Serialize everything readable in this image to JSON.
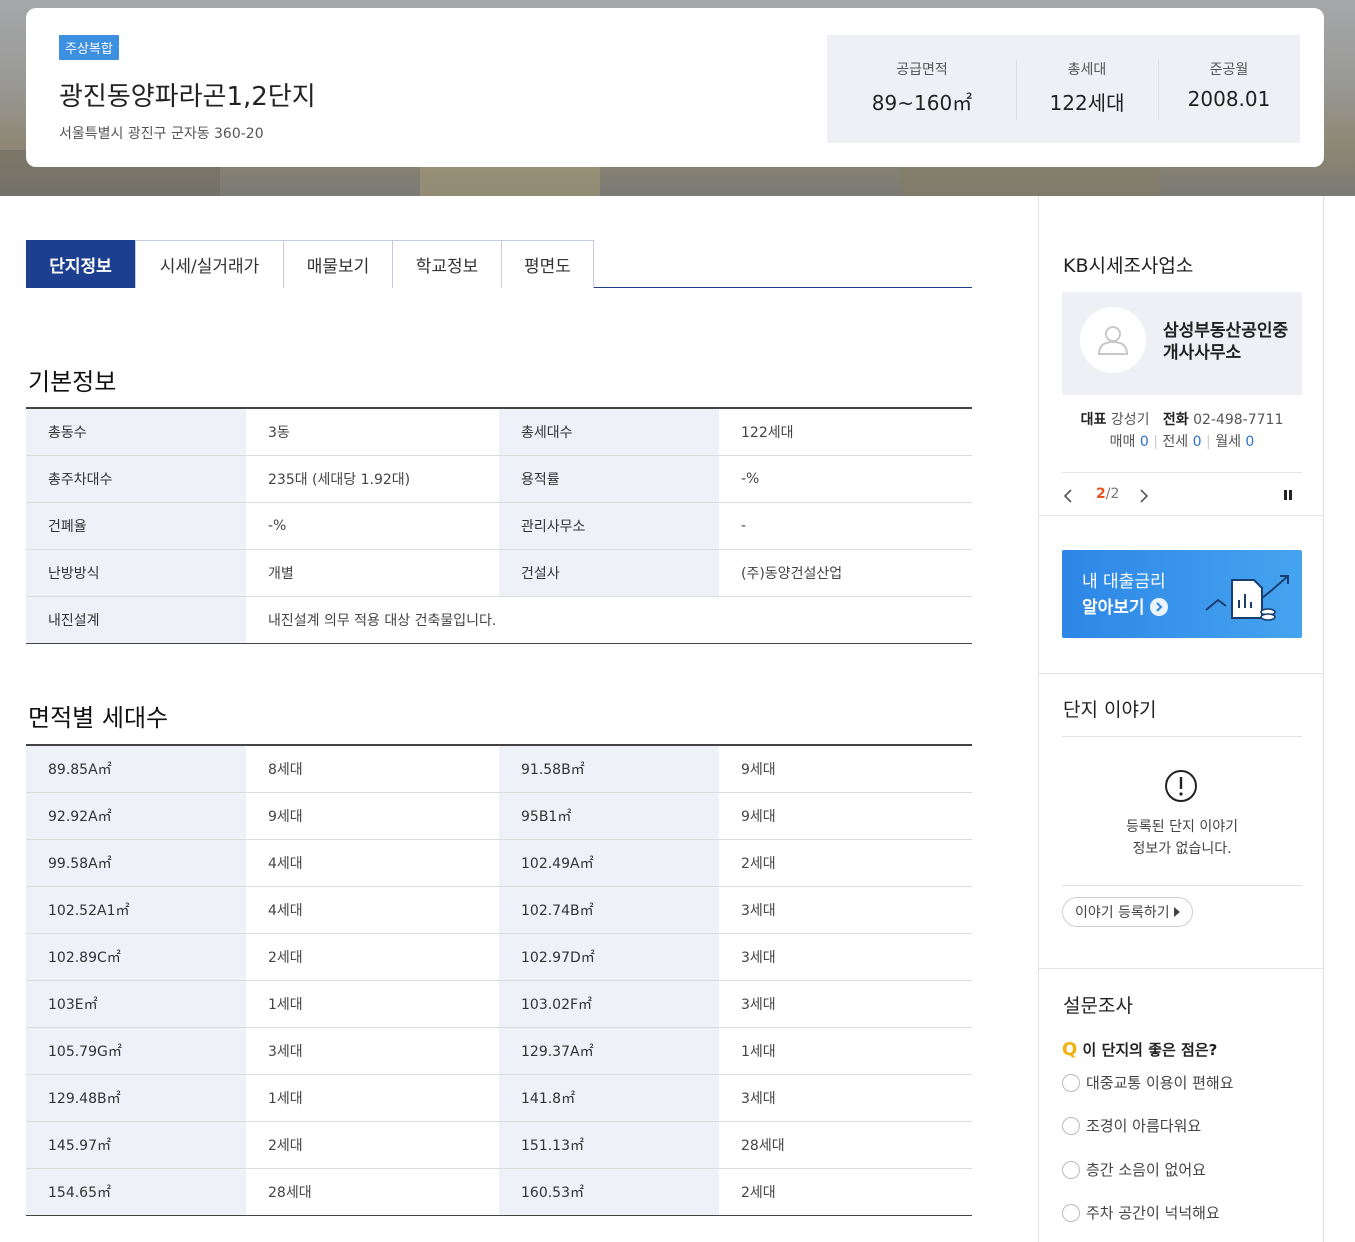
{
  "complex": {
    "badge": "주상복합",
    "name": "광진동양파라곤1,2단지",
    "address": "서울특별시 광진구 군자동 360-20"
  },
  "summary": [
    {
      "label": "공급면적",
      "value": "89~160㎡"
    },
    {
      "label": "총세대",
      "value": "122세대"
    },
    {
      "label": "준공월",
      "value": "2008.01"
    }
  ],
  "tabs": [
    "단지정보",
    "시세/실거래가",
    "매물보기",
    "학교정보",
    "평면도"
  ],
  "basic": {
    "title": "기본정보",
    "rows": [
      [
        "총동수",
        "3동",
        "총세대수",
        "122세대"
      ],
      [
        "총주차대수",
        "235대 (세대당 1.92대)",
        "용적률",
        "-%"
      ],
      [
        "건폐율",
        "-%",
        "관리사무소",
        "-"
      ],
      [
        "난방방식",
        "개별",
        "건설사",
        "(주)동양건설산업"
      ]
    ],
    "seismic_label": "내진설계",
    "seismic_value": "내진설계 의무 적용 대상 건축물입니다."
  },
  "area": {
    "title": "면적별 세대수",
    "rows": [
      [
        "89.85A㎡",
        "8세대",
        "91.58B㎡",
        "9세대"
      ],
      [
        "92.92A㎡",
        "9세대",
        "95B1㎡",
        "9세대"
      ],
      [
        "99.58A㎡",
        "4세대",
        "102.49A㎡",
        "2세대"
      ],
      [
        "102.52A1㎡",
        "4세대",
        "102.74B㎡",
        "3세대"
      ],
      [
        "102.89C㎡",
        "2세대",
        "102.97D㎡",
        "3세대"
      ],
      [
        "103E㎡",
        "1세대",
        "103.02F㎡",
        "3세대"
      ],
      [
        "105.79G㎡",
        "3세대",
        "129.37A㎡",
        "1세대"
      ],
      [
        "129.48B㎡",
        "1세대",
        "141.8㎡",
        "3세대"
      ],
      [
        "145.97㎡",
        "2세대",
        "151.13㎡",
        "28세대"
      ],
      [
        "154.65㎡",
        "28세대",
        "160.53㎡",
        "2세대"
      ]
    ]
  },
  "sidebar": {
    "kb_title": "KB시세조사업소",
    "agent_name": "삼성부동산공인중개사사무소",
    "rep_label": "대표",
    "rep_name": "강성기",
    "tel_label": "전화",
    "tel": "02-498-7711",
    "sale_label": "매매",
    "sale_count": "0",
    "jeonse_label": "전세",
    "jeonse_count": "0",
    "monthly_label": "월세",
    "monthly_count": "0",
    "page_current": "2",
    "page_total": "/2",
    "loan_line1": "내 대출금리",
    "loan_line2": "알아보기",
    "story_title": "단지 이야기",
    "story_empty_1": "등록된 단지 이야기",
    "story_empty_2": "정보가 없습니다.",
    "story_button": "이야기 등록하기",
    "survey_title": "설문조사",
    "survey_q_mark": "Q",
    "survey_question": "이 단지의 좋은 점은?",
    "survey_options": [
      "대중교통 이용이 편해요",
      "조경이 아름다워요",
      "층간 소음이 없어요",
      "주차 공간이 넉넉해요"
    ]
  }
}
